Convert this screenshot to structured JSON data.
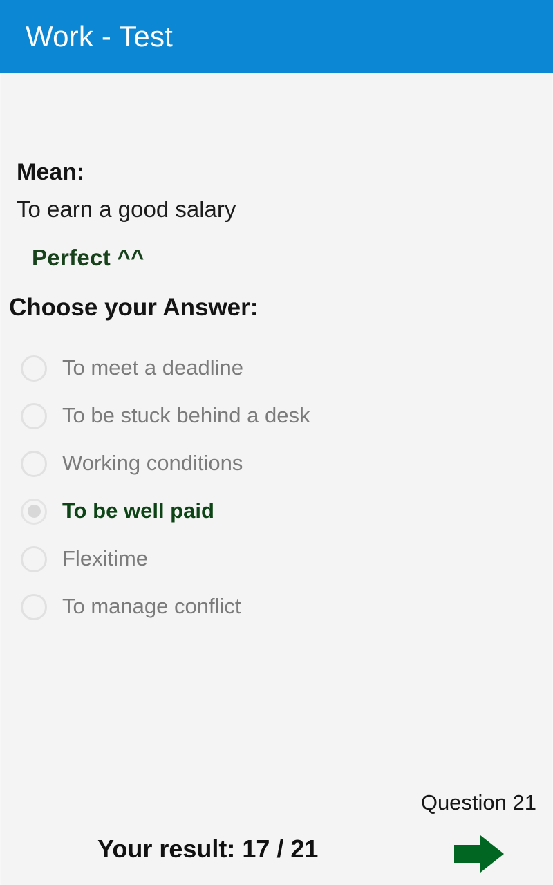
{
  "appbar": {
    "title": "Work - Test",
    "background": "#0b87d4",
    "title_color": "#ffffff"
  },
  "question": {
    "mean_label": "Mean:",
    "mean_value": "To earn a good salary",
    "verdict": "Perfect ^^",
    "verdict_color": "#17421c",
    "choose_label": "Choose your Answer:"
  },
  "answers": [
    {
      "label": "To meet a deadline",
      "selected": false
    },
    {
      "label": "To be stuck behind a desk",
      "selected": false
    },
    {
      "label": "Working conditions",
      "selected": false
    },
    {
      "label": "To be well paid",
      "selected": true
    },
    {
      "label": "Flexitime",
      "selected": false
    },
    {
      "label": "To manage conflict",
      "selected": false
    }
  ],
  "footer": {
    "question_counter": "Question 21",
    "result_text": "Your result: 17 / 21",
    "next_icon": "arrow-right-icon",
    "next_icon_color": "#006622"
  },
  "theme": {
    "page_background": "#f4f4f4",
    "radio_ring": "#e1e1e1",
    "radio_dot": "#d8d8d8",
    "answer_text": "#7b7b7b",
    "selected_answer_text": "#0d4415"
  }
}
